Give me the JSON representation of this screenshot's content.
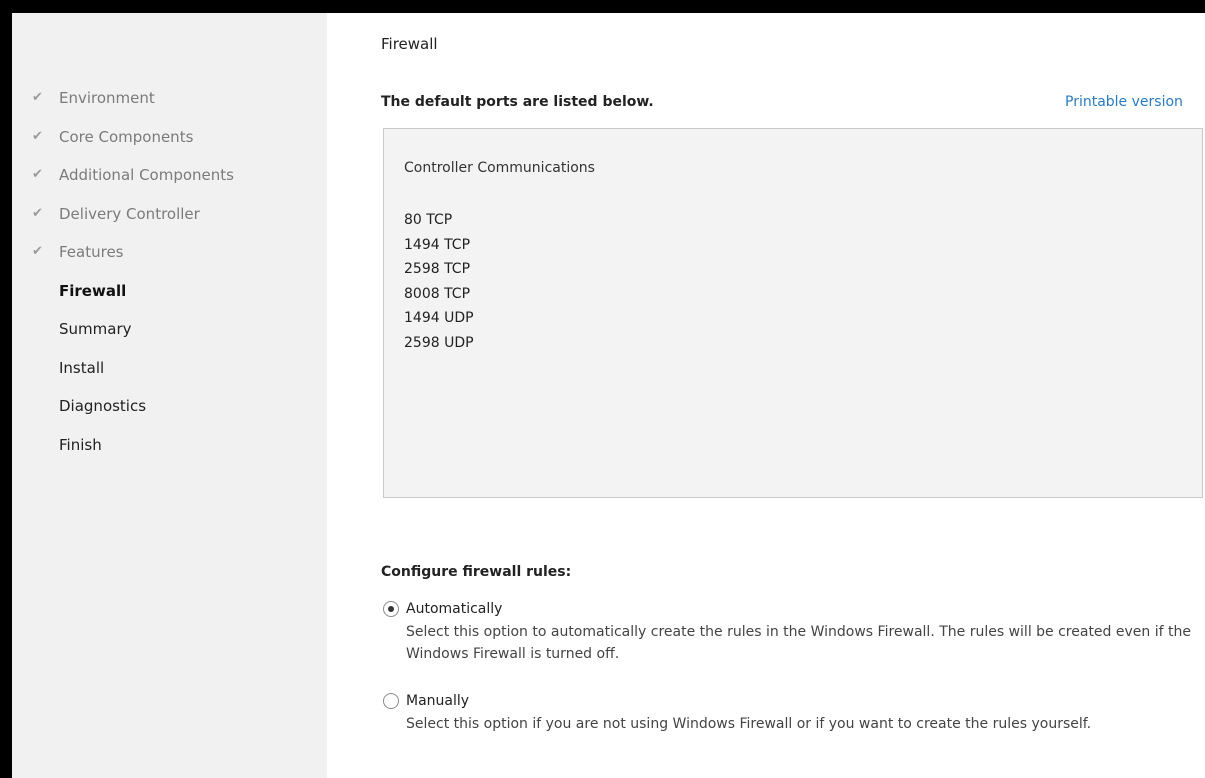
{
  "sidebar": {
    "steps": [
      {
        "label": "Environment",
        "state": "done"
      },
      {
        "label": "Core Components",
        "state": "done"
      },
      {
        "label": "Additional Components",
        "state": "done"
      },
      {
        "label": "Delivery Controller",
        "state": "done"
      },
      {
        "label": "Features",
        "state": "done"
      },
      {
        "label": "Firewall",
        "state": "current"
      },
      {
        "label": "Summary",
        "state": "pending"
      },
      {
        "label": "Install",
        "state": "pending"
      },
      {
        "label": "Diagnostics",
        "state": "pending"
      },
      {
        "label": "Finish",
        "state": "pending"
      }
    ],
    "check_glyph": "✔"
  },
  "main": {
    "title": "Firewall",
    "intro": "The default ports are listed below.",
    "printable_link": "Printable version",
    "ports_box": {
      "heading": "Controller Communications",
      "ports": [
        "80 TCP",
        "1494 TCP",
        "2598 TCP",
        "8008 TCP",
        "1494 UDP",
        "2598 UDP"
      ]
    },
    "configure_title": "Configure firewall rules:",
    "options": [
      {
        "label": "Automatically",
        "description": "Select this option to automatically create the rules in the Windows Firewall.  The rules will be created even if the Windows Firewall is turned off.",
        "selected": true
      },
      {
        "label": "Manually",
        "description": "Select this option if you are not using Windows Firewall or if you want to create the rules yourself.",
        "selected": false
      }
    ]
  },
  "colors": {
    "sidebar_bg": "#f1f1f1",
    "link": "#2b7bbf",
    "ports_box_bg": "#f3f3f3"
  }
}
